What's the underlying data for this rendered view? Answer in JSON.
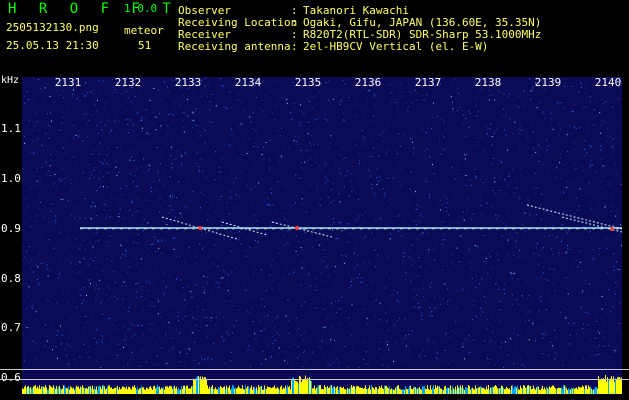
{
  "header": {
    "app_title": "H R O F F T",
    "app_version": "1.0.0",
    "file_name": "2505132130.png",
    "meteor_label": "meteor",
    "date_time": "25.05.13 21:30",
    "meteor_count": "51",
    "info": [
      {
        "label": "Observer",
        "value": "Takanori Kawachi"
      },
      {
        "label": "Receiving Location",
        "value": "Ogaki, Gifu, JAPAN (136.60E, 35.35N)"
      },
      {
        "label": "Receiver",
        "value": "R820T2(RTL-SDR) SDR-Sharp 53.1000MHz"
      },
      {
        "label": "Receiving antenna",
        "value": "2el-HB9CV Vertical (el. E-W)"
      }
    ],
    "separator": ":"
  },
  "spectrogram": {
    "unit_label": "kHz",
    "minute_labels": [
      "2131",
      "2132",
      "2133",
      "2134",
      "2135",
      "2136",
      "2137",
      "2138",
      "2139",
      "2140"
    ],
    "freq_labels": [
      "1.1",
      "1.0",
      "0.9",
      "0.8",
      "0.7",
      "0.6"
    ]
  },
  "colors": {
    "title": "#00ff00",
    "text": "#ffffff",
    "info_text": "#ffff66",
    "background": "#000000",
    "plot_bg": "#0a0a56",
    "noise": "#2a6cff",
    "signal": "#ffffff",
    "echo": "#ff4040",
    "level": "#ffff00",
    "level_bg": "#00aaff"
  }
}
